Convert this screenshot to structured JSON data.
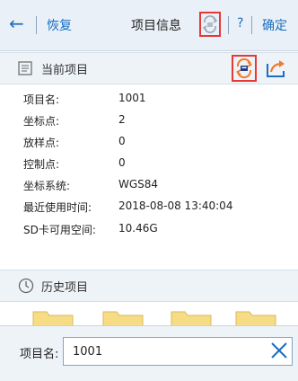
{
  "topbar": {
    "back_glyph": "←",
    "restore": "恢复",
    "title": "项目信息",
    "help": "?",
    "confirm": "确定"
  },
  "current_section": {
    "label": "当前项目"
  },
  "info": [
    {
      "key": "项目名:",
      "value": "1001"
    },
    {
      "key": "坐标点:",
      "value": "2"
    },
    {
      "key": "放样点:",
      "value": "0"
    },
    {
      "key": "控制点:",
      "value": "0"
    },
    {
      "key": "坐标系统:",
      "value": "WGS84"
    },
    {
      "key": "最近使用时间:",
      "value": "2018-08-08 13:40:04"
    },
    {
      "key": "SD卡可用空间:",
      "value": "10.46G"
    }
  ],
  "history_section": {
    "label": "历史项目"
  },
  "search": {
    "label": "项目名:",
    "value": "1001"
  },
  "colors": {
    "accent": "#1b6ec2",
    "highlight": "#e53935",
    "folder": "#f7dc86",
    "share": "#f07a2d"
  },
  "icons": {
    "back": "arrow-left-icon",
    "sync_disabled": "cloud-sync-icon",
    "sync_active": "cloud-sync-icon",
    "share": "share-arrow-icon",
    "document": "document-icon",
    "history": "clock-icon",
    "clear": "close-icon"
  }
}
